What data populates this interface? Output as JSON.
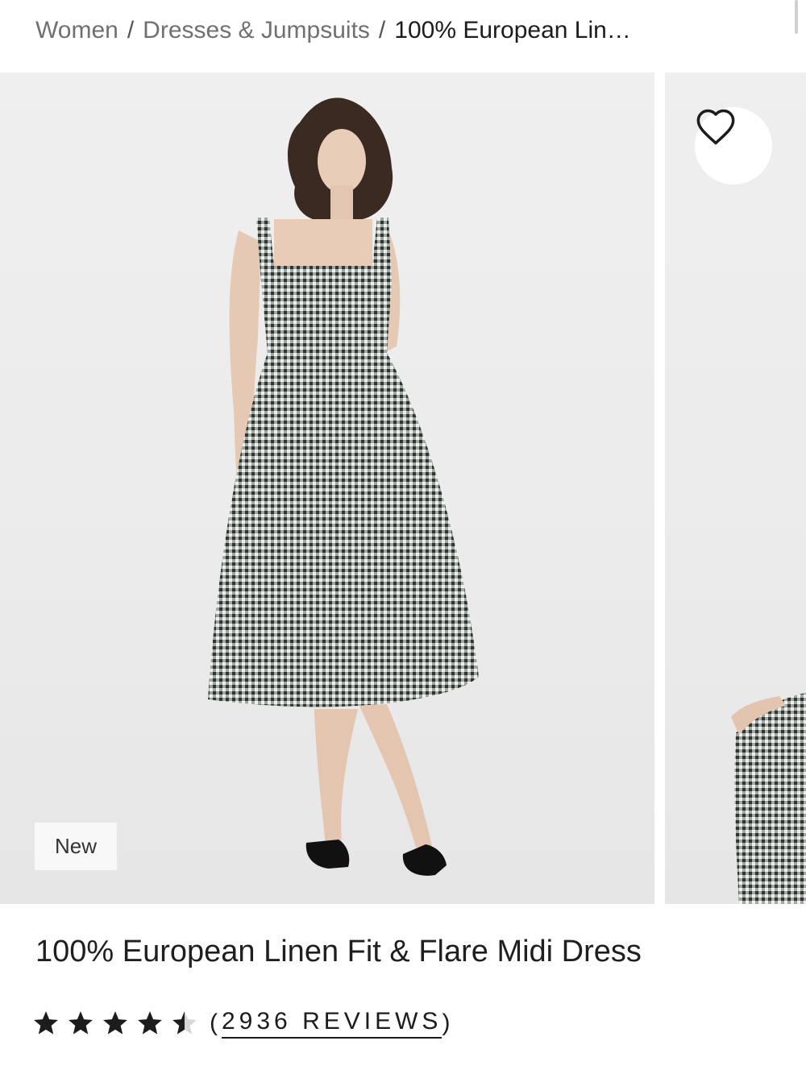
{
  "breadcrumb": {
    "items": [
      "Women",
      "Dresses & Jumpsuits"
    ],
    "current": "100% European Lin…",
    "separator": "/"
  },
  "gallery": {
    "badge": "New",
    "wishlist_icon": "heart-outline-icon"
  },
  "product": {
    "title": "100% European Linen Fit & Flare Midi Dress",
    "rating": 4.5,
    "rating_max": 5,
    "reviews_open": "(",
    "reviews_label": "2936 REVIEWS",
    "reviews_close": ")"
  },
  "colors": {
    "text": "#1c1c1c",
    "muted": "#707070",
    "photo_bg": "#ececec"
  }
}
